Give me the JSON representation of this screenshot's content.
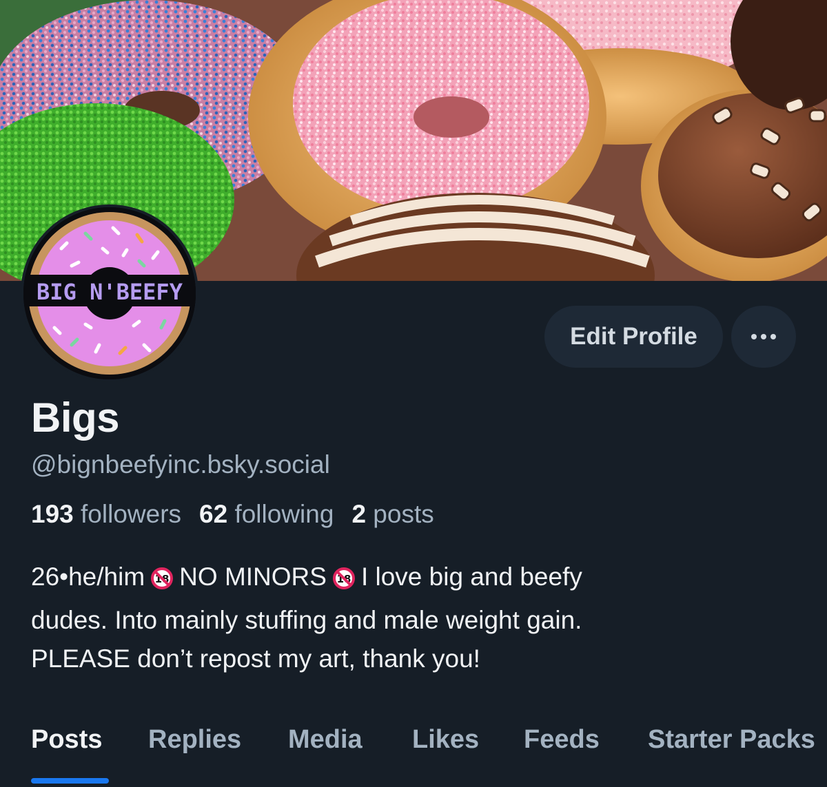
{
  "banner": {
    "description_icon": "donuts-banner"
  },
  "avatar": {
    "logo_text": "BIG N' BEEFY"
  },
  "actions": {
    "edit_profile_label": "Edit Profile",
    "more_icon": "ellipsis-icon"
  },
  "profile": {
    "display_name": "Bigs",
    "handle": "@bignbeefyinc.bsky.social"
  },
  "stats": {
    "followers_count": "193",
    "followers_label": "followers",
    "following_count": "62",
    "following_label": "following",
    "posts_count": "2",
    "posts_label": "posts"
  },
  "bio": {
    "line1_a": "26•he/him",
    "line1_b": "NO MINORS",
    "line1_c": "I love big and beefy",
    "line2": "dudes. Into mainly stuffing and male weight gain.",
    "line3": "PLEASE don’t repost my art, thank you!",
    "adult_icon": "no-under-18-icon"
  },
  "tabs": [
    {
      "label": "Posts",
      "active": true
    },
    {
      "label": "Replies"
    },
    {
      "label": "Media"
    },
    {
      "label": "Likes"
    },
    {
      "label": "Feeds"
    },
    {
      "label": "Starter Packs"
    }
  ],
  "colors": {
    "background": "#161e27",
    "button_bg": "#1e2936",
    "text_primary": "#f1f3f5",
    "text_secondary": "#a3b2c1",
    "accent": "#1a78f0"
  }
}
